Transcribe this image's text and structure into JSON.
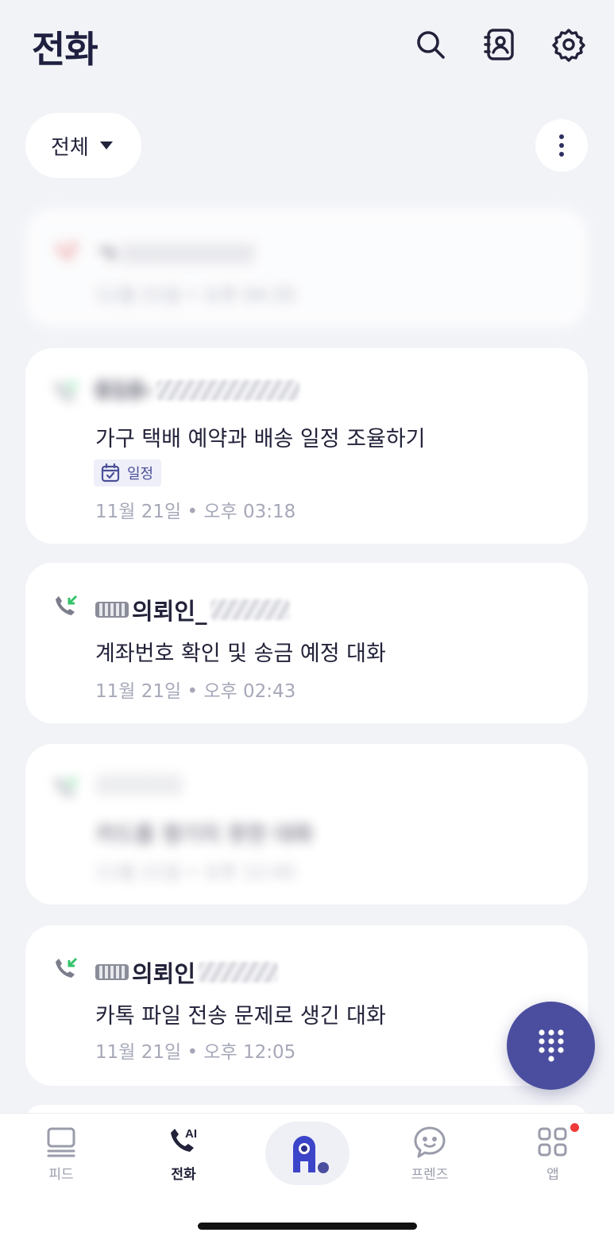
{
  "header": {
    "title": "전화",
    "icons": [
      "search-icon",
      "contacts-book-icon",
      "gear-icon"
    ]
  },
  "filter": {
    "label": "전체"
  },
  "colors": {
    "accent": "#4b4e9f",
    "missed": "#e24b4b",
    "incoming": "#34c36a",
    "meta_text": "#a6a8b8",
    "notification_dot": "#ee3a3a"
  },
  "calls": [
    {
      "type": "missed",
      "name": "ㄱ",
      "summary": "",
      "tag": "",
      "datetime": "11월 21일 • 오후 04:35"
    },
    {
      "type": "incoming",
      "name": "010-",
      "summary": "가구 택배 예약과 배송 일정 조율하기",
      "tag": "일정",
      "datetime": "11월 21일 • 오후 03:18"
    },
    {
      "type": "incoming",
      "name": "의뢰인_",
      "summary": "계좌번호 확인 및 송금 예정 대화",
      "tag": "",
      "datetime": "11월 21일 • 오후 02:43"
    },
    {
      "type": "incoming",
      "name": "",
      "summary": "카드를 챙기지 못한 대화",
      "tag": "",
      "datetime": "11월 21일 • 오후 12:45"
    },
    {
      "type": "incoming",
      "name": "의뢰인",
      "summary": "카톡 파일 전송 문제로 생긴 대화",
      "tag": "",
      "datetime": "11월 21일 • 오후 12:05"
    }
  ],
  "bottom_nav": {
    "items": [
      {
        "label": "피드",
        "icon": "feed-icon",
        "active": false
      },
      {
        "label": "전화",
        "icon": "ai-call-icon",
        "active": true
      },
      {
        "label": "",
        "icon": "assistant-character-icon",
        "active": false
      },
      {
        "label": "프렌즈",
        "icon": "chat-bubble-icon",
        "active": false
      },
      {
        "label": "앱",
        "icon": "apps-grid-icon",
        "active": false,
        "badge": true
      }
    ]
  }
}
